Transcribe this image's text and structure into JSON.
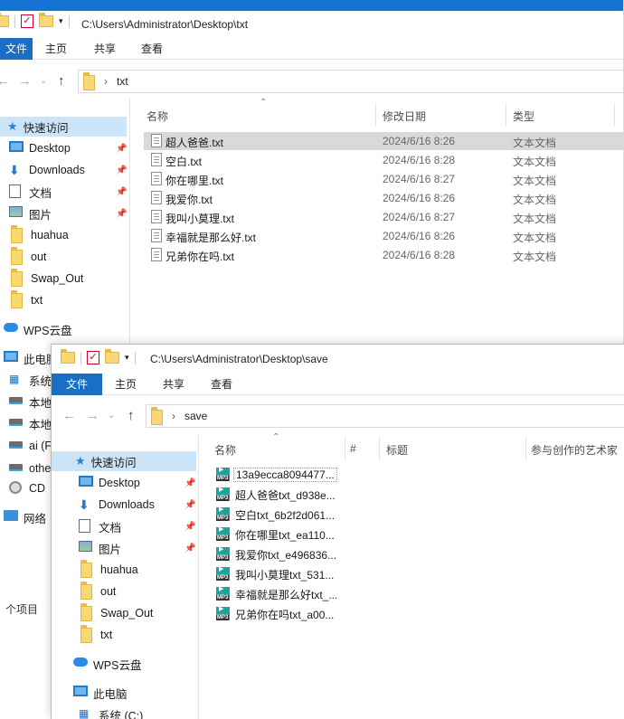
{
  "window1": {
    "path": "C:\\Users\\Administrator\\Desktop\\txt",
    "ribbon": [
      "文件",
      "主页",
      "共享",
      "查看"
    ],
    "breadcrumb": "txt",
    "columns": [
      "名称",
      "修改日期",
      "类型"
    ],
    "files": [
      {
        "name": "超人爸爸.txt",
        "date": "2024/6/16 8:26",
        "type": "文本文档"
      },
      {
        "name": "空白.txt",
        "date": "2024/6/16 8:28",
        "type": "文本文档"
      },
      {
        "name": "你在哪里.txt",
        "date": "2024/6/16 8:27",
        "type": "文本文档"
      },
      {
        "name": "我爱你.txt",
        "date": "2024/6/16 8:26",
        "type": "文本文档"
      },
      {
        "name": "我叫小莫理.txt",
        "date": "2024/6/16 8:27",
        "type": "文本文档"
      },
      {
        "name": "幸福就是那么好.txt",
        "date": "2024/6/16 8:26",
        "type": "文本文档"
      },
      {
        "name": "兄弟你在吗.txt",
        "date": "2024/6/16 8:28",
        "type": "文本文档"
      }
    ],
    "sidebar": {
      "quick_access": "快速访问",
      "items": [
        "Desktop",
        "Downloads",
        "文档",
        "图片",
        "huahua",
        "out",
        "Swap_Out",
        "txt"
      ],
      "wps": "WPS云盘",
      "this_pc": "此电脑",
      "drives": [
        "系统",
        "本地",
        "本地",
        "ai (F",
        "othe",
        "CD "
      ],
      "network": "网络"
    },
    "status": "个项目"
  },
  "window2": {
    "path": "C:\\Users\\Administrator\\Desktop\\save",
    "ribbon": [
      "文件",
      "主页",
      "共享",
      "查看"
    ],
    "breadcrumb": "save",
    "columns": [
      "名称",
      "#",
      "标题",
      "参与创作的艺术家"
    ],
    "files": [
      "13a9ecca8094477...",
      "超人爸爸txt_d938e...",
      "空白txt_6b2f2d061...",
      "你在哪里txt_ea110...",
      "我爱你txt_e496836...",
      "我叫小莫理txt_531...",
      "幸福就是那么好txt_...",
      "兄弟你在吗txt_a00..."
    ],
    "sidebar": {
      "quick_access": "快速访问",
      "items": [
        "Desktop",
        "Downloads",
        "文档",
        "图片",
        "huahua",
        "out",
        "Swap_Out",
        "txt"
      ],
      "wps": "WPS云盘",
      "this_pc": "此电脑",
      "drive": "系统 (C:)"
    }
  },
  "colors": {
    "accent": "#1a6fc4",
    "selection": "#cce4f7",
    "row_selected": "#d9d9d9",
    "mp3": "#1ba39c"
  }
}
